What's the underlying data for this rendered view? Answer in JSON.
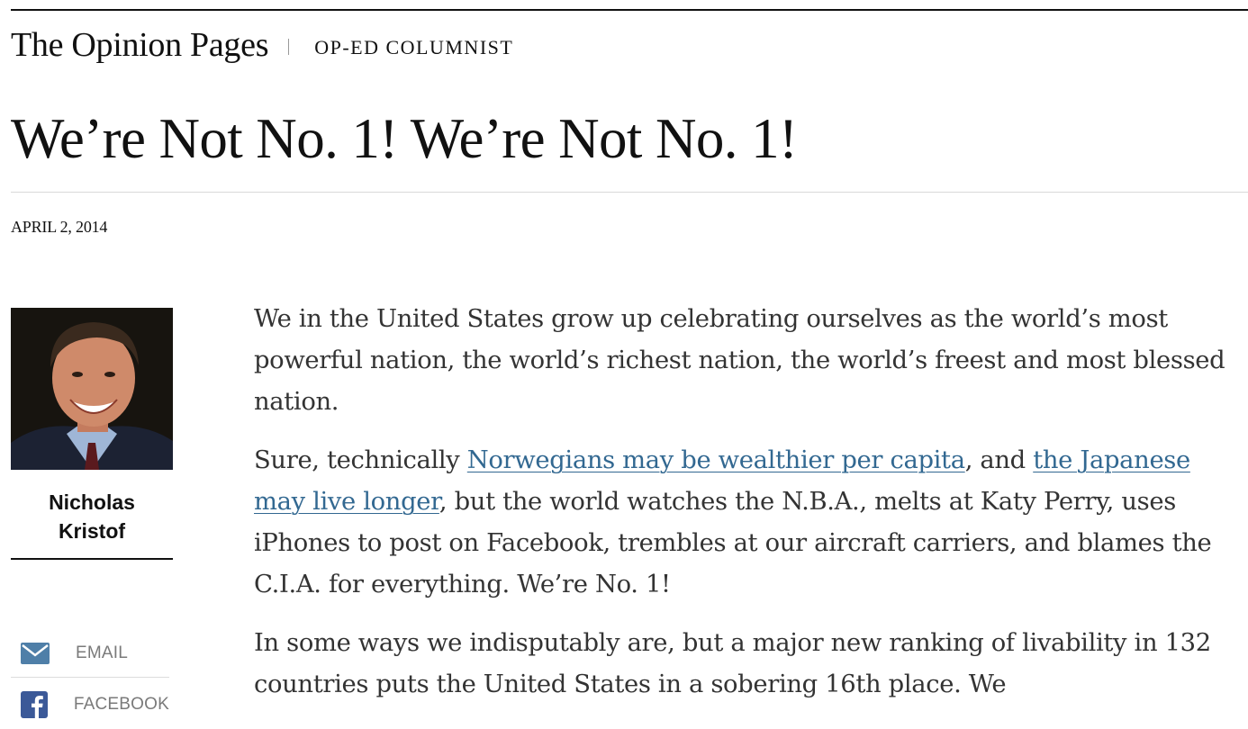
{
  "header": {
    "section_name": "The Opinion Pages",
    "kicker": "OP-ED COLUMNIST"
  },
  "article": {
    "headline": "We’re Not No. 1! We’re Not No. 1!",
    "date": "APRIL 2, 2014",
    "paragraphs": [
      {
        "text": "We in the United States grow up celebrating ourselves as the world’s most powerful nation, the world’s richest nation, the world’s freest and most blessed nation."
      },
      {
        "part1": "Sure, technically ",
        "link1": "Norwegians may be wealthier per capita",
        "part2": ", and ",
        "link2": "the Japanese may live longer",
        "part3": ", but the world watches the N.B.A., melts at Katy Perry, uses iPhones to post on Facebook, trembles at our aircraft carriers, and blames the C.I.A. for everything. We’re No. 1!"
      },
      {
        "text": "In some ways we indisputably are, but a major new ranking of livability in 132 countries puts the United States in a sobering 16th place. We"
      }
    ]
  },
  "author": {
    "name_line1": "Nicholas",
    "name_line2": "Kristof"
  },
  "share": [
    {
      "label": "EMAIL",
      "icon": "envelope-icon"
    },
    {
      "label": "FACEBOOK",
      "icon": "facebook-icon"
    }
  ],
  "colors": {
    "link": "#326891",
    "body_text": "#333333",
    "share_text": "#7a7a7a",
    "facebook_blue": "#3b5998"
  }
}
